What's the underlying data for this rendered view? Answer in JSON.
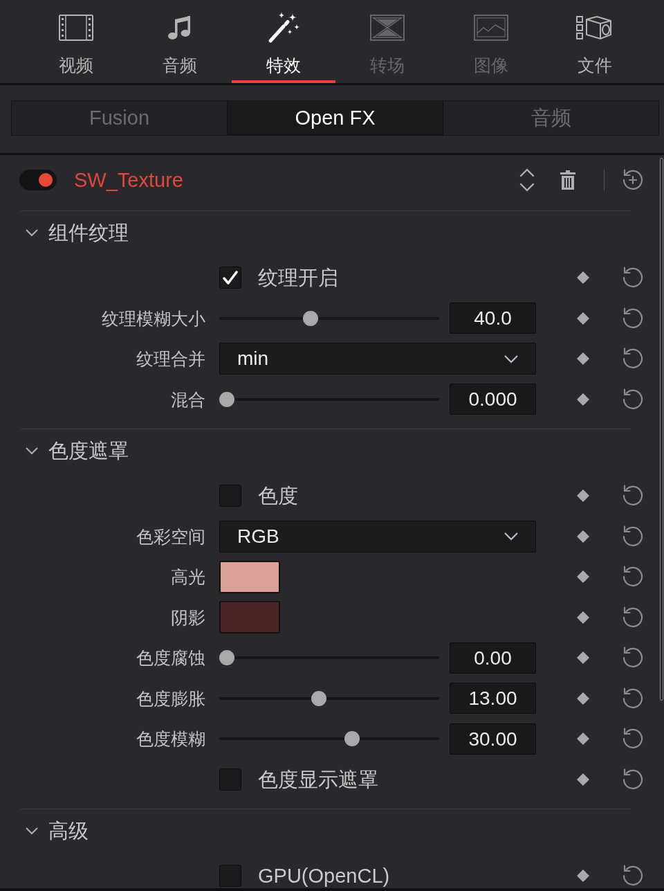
{
  "media_tabs": [
    {
      "label": "视频",
      "selected": false,
      "disabled": false
    },
    {
      "label": "音频",
      "selected": false,
      "disabled": false
    },
    {
      "label": "特效",
      "selected": true,
      "disabled": false
    },
    {
      "label": "转场",
      "selected": false,
      "disabled": true
    },
    {
      "label": "图像",
      "selected": false,
      "disabled": true
    },
    {
      "label": "文件",
      "selected": false,
      "disabled": false
    }
  ],
  "sub_tabs": [
    {
      "label": "Fusion",
      "selected": false
    },
    {
      "label": "Open FX",
      "selected": true
    },
    {
      "label": "音频",
      "selected": false
    }
  ],
  "effect": {
    "name": "SW_Texture",
    "enabled": true
  },
  "sections": [
    {
      "title": "组件纹理",
      "expanded": true,
      "rows": [
        {
          "kind": "checkbox",
          "label": "纹理开启",
          "checked": true
        },
        {
          "kind": "slider",
          "label": "纹理模糊大小",
          "level": 0.41,
          "reading": "40.0"
        },
        {
          "kind": "dropdown",
          "label": "纹理合并",
          "value": "min"
        },
        {
          "kind": "slider",
          "label": "混合",
          "level": 0,
          "reading": "0.000"
        }
      ]
    },
    {
      "title": "色度遮罩",
      "expanded": true,
      "rows": [
        {
          "kind": "checkbox",
          "label": "色度",
          "checked": false
        },
        {
          "kind": "dropdown",
          "label": "色彩空间",
          "value": "RGB"
        },
        {
          "kind": "color",
          "label": "高光",
          "color": "#d9a197"
        },
        {
          "kind": "color",
          "label": "阴影",
          "color": "#4b2526"
        },
        {
          "kind": "slider",
          "label": "色度腐蚀",
          "level": 0,
          "reading": "0.00"
        },
        {
          "kind": "slider",
          "label": "色度膨胀",
          "level": 0.45,
          "reading": "13.00"
        },
        {
          "kind": "slider",
          "label": "色度模糊",
          "level": 0.61,
          "reading": "30.00"
        },
        {
          "kind": "checkbox",
          "label": "色度显示遮罩",
          "checked": false
        }
      ]
    },
    {
      "title": "高级",
      "expanded": true,
      "rows": [
        {
          "kind": "checkbox",
          "label": "GPU(OpenCL)",
          "checked": false
        }
      ]
    }
  ]
}
